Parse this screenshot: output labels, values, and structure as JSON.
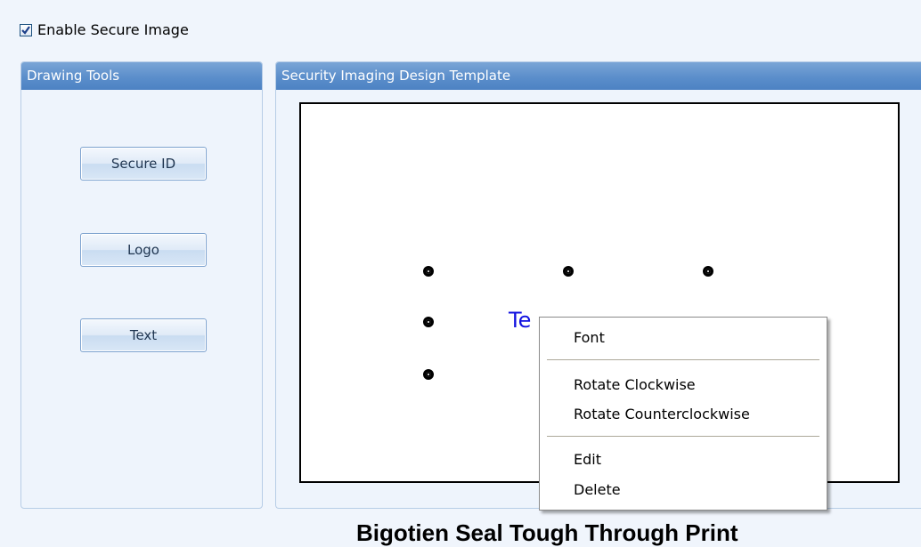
{
  "top": {
    "enable_label": "Enable Secure Image",
    "enable_checked": true
  },
  "tools_panel": {
    "title": "Drawing Tools",
    "buttons": [
      "Secure ID",
      "Logo",
      "Text"
    ]
  },
  "template_panel": {
    "title": "Security Imaging Design Template",
    "canvas_text": "Te"
  },
  "context_menu": {
    "items": [
      "Font",
      "Rotate Clockwise",
      "Rotate Counterclockwise",
      "Edit",
      "Delete"
    ]
  },
  "bottom_caption": "Bigotien Seal Tough Through Print",
  "colors": {
    "header": "#5b8ecb",
    "canvas_text": "#1010e0",
    "background": "#f0f5fc"
  },
  "icons": {
    "checkbox": "checkmark-icon",
    "handles": "resize-handle-icon"
  }
}
